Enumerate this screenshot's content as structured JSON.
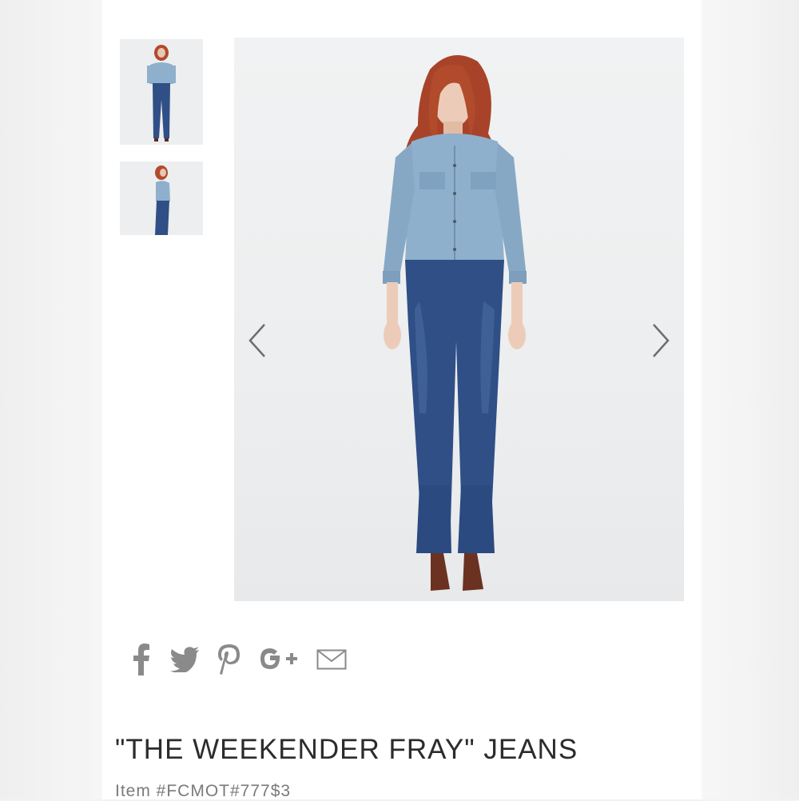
{
  "product": {
    "title": "\"THE WEEKENDER FRAY\" JEANS",
    "item_number": "Item #FCMOT#777$3"
  },
  "gallery": {
    "thumbnails": [
      "front-full-view",
      "side-view"
    ],
    "prev_icon": "chevron-left-icon",
    "next_icon": "chevron-right-icon"
  },
  "share": {
    "icons": [
      "facebook-icon",
      "twitter-icon",
      "pinterest-icon",
      "google-plus-icon",
      "email-icon"
    ]
  },
  "colors": {
    "icon_gray": "#8a8a8a",
    "denim_shirt": "#8fb0cc",
    "denim_jeans": "#2f4f86",
    "hair": "#b24a2c"
  }
}
